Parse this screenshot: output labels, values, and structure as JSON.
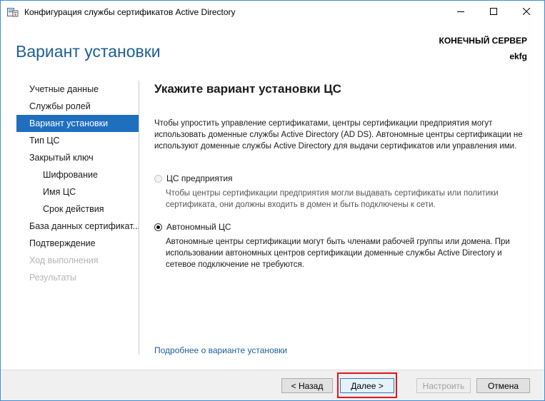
{
  "window": {
    "title": "Конфигурация службы сертификатов Active Directory",
    "accent_color": "#1f6fbf",
    "icons": {
      "app": "certificate-server-icon",
      "minimize": "minimize-icon",
      "maximize": "maximize-icon",
      "close": "close-icon"
    }
  },
  "header": {
    "title": "Вариант установки",
    "server_label": "КОНЕЧНЫЙ СЕРВЕР",
    "server_name": "ekfg"
  },
  "sidebar": {
    "items": [
      {
        "label": "Учетные данные",
        "state": "normal",
        "level": 0
      },
      {
        "label": "Службы ролей",
        "state": "normal",
        "level": 0
      },
      {
        "label": "Вариант установки",
        "state": "selected",
        "level": 0
      },
      {
        "label": "Тип ЦС",
        "state": "normal",
        "level": 0
      },
      {
        "label": "Закрытый ключ",
        "state": "normal",
        "level": 0
      },
      {
        "label": "Шифрование",
        "state": "normal",
        "level": 1
      },
      {
        "label": "Имя ЦС",
        "state": "normal",
        "level": 1
      },
      {
        "label": "Срок действия",
        "state": "normal",
        "level": 1
      },
      {
        "label": "База данных сертификат...",
        "state": "normal",
        "level": 0
      },
      {
        "label": "Подтверждение",
        "state": "normal",
        "level": 0
      },
      {
        "label": "Ход выполнения",
        "state": "disabled",
        "level": 0
      },
      {
        "label": "Результаты",
        "state": "disabled",
        "level": 0
      }
    ]
  },
  "main": {
    "heading": "Укажите вариант установки ЦС",
    "description": "Чтобы упростить управление сертификатами, центры сертификации предприятия могут использовать доменные службы Active Directory (AD DS). Автономные центры сертификации не используют доменные службы Active Directory для выдачи сертификатов или управления ими.",
    "options": [
      {
        "label": "ЦС предприятия",
        "selected": false,
        "enabled": false,
        "description": "Чтобы центры сертификации предприятия могли выдавать сертификаты или политики сертификата, они должны входить в домен и быть подключены к сети."
      },
      {
        "label": "Автономный ЦС",
        "selected": true,
        "enabled": true,
        "description": "Автономные центры сертификации могут быть членами рабочей группы или домена. При использовании автономных центров сертификации доменные службы Active Directory и сетевое подключение не требуются."
      }
    ],
    "more_link": "Подробнее о варианте установки"
  },
  "footer": {
    "back_label": "< Назад",
    "next_label": "Далее >",
    "configure_label": "Настроить",
    "cancel_label": "Отмена",
    "highlight_color": "#e0161e"
  }
}
